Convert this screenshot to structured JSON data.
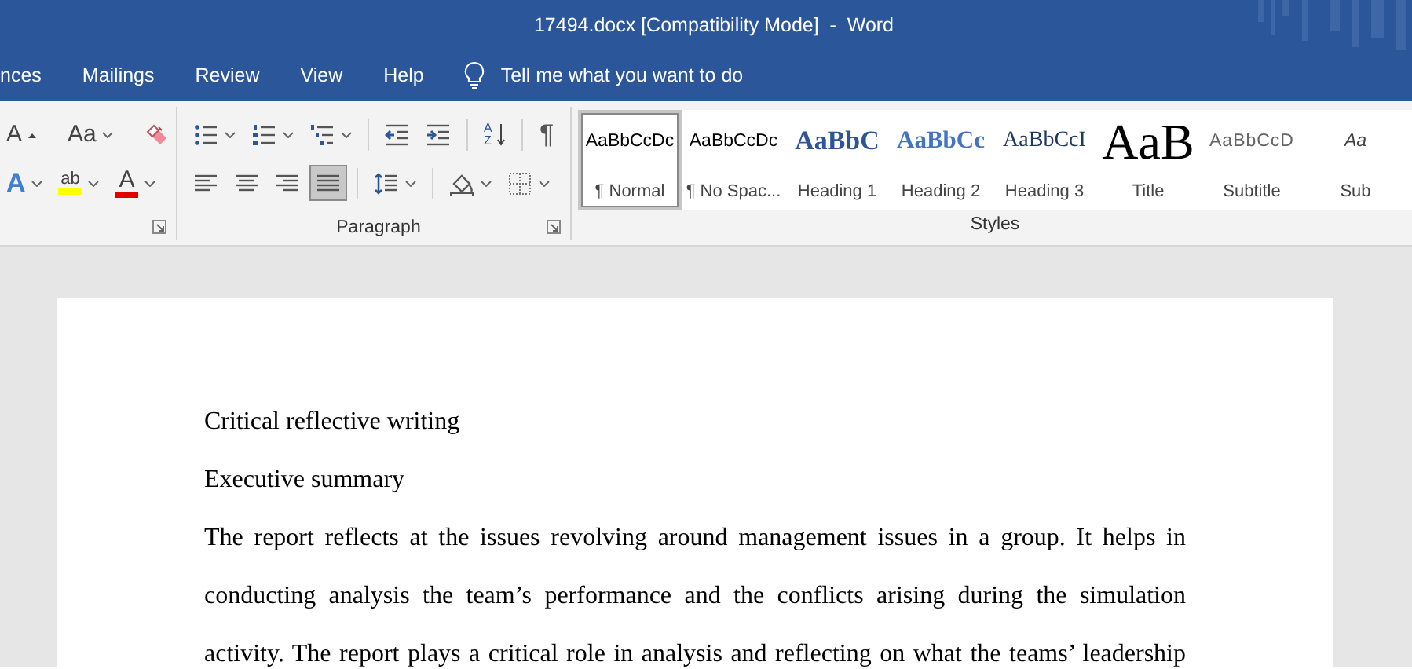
{
  "window": {
    "title": "17494.docx [Compatibility Mode]  -  Word"
  },
  "tabs": [
    {
      "label": "nces",
      "selected": false
    },
    {
      "label": "Mailings",
      "selected": false
    },
    {
      "label": "Review",
      "selected": false
    },
    {
      "label": "View",
      "selected": false
    },
    {
      "label": "Help",
      "selected": false
    }
  ],
  "tell_me": {
    "placeholder": "Tell me what you want to do"
  },
  "ribbon": {
    "font_group": {
      "upper": [
        {
          "kind": "shrink",
          "glyph": "A"
        },
        {
          "kind": "separator"
        },
        {
          "kind": "case",
          "glyph": "Aa",
          "dropdown": true
        },
        {
          "kind": "separator"
        },
        {
          "kind": "eraser"
        }
      ],
      "lower": [
        {
          "kind": "effects",
          "glyph": "A",
          "dropdown": true
        },
        {
          "kind": "highlight",
          "glyph": "ab",
          "dropdown": true
        },
        {
          "kind": "font-color",
          "glyph": "A",
          "dropdown": true
        }
      ]
    },
    "paragraph_group": {
      "label": "Paragraph",
      "rows": [
        [
          {
            "kind": "bullets",
            "dropdown": true
          },
          {
            "kind": "numbering",
            "dropdown": true
          },
          {
            "kind": "multilevel",
            "dropdown": true
          },
          {
            "kind": "separator"
          },
          {
            "kind": "outdent"
          },
          {
            "kind": "indent"
          },
          {
            "kind": "separator"
          },
          {
            "kind": "sort",
            "glyph": "AZ"
          },
          {
            "kind": "separator"
          },
          {
            "kind": "pilcrow",
            "glyph": "¶"
          }
        ],
        [
          {
            "kind": "align-left",
            "selected": false
          },
          {
            "kind": "align-center",
            "selected": false
          },
          {
            "kind": "align-right",
            "selected": false
          },
          {
            "kind": "justify",
            "selected": true
          },
          {
            "kind": "separator"
          },
          {
            "kind": "line-spacing",
            "dropdown": true
          },
          {
            "kind": "separator"
          },
          {
            "kind": "shading",
            "dropdown": true
          },
          {
            "kind": "borders",
            "dropdown": true
          }
        ]
      ]
    },
    "styles_group": {
      "label": "Styles",
      "styles": [
        {
          "kind": "normal",
          "preview": "AaBbCcDc",
          "name": "¶ Normal",
          "selected": true
        },
        {
          "kind": "normal",
          "preview": "AaBbCcDc",
          "name": "¶ No Spac...",
          "selected": false
        },
        {
          "kind": "heading1",
          "preview": "AaBbC",
          "name": "Heading 1",
          "selected": false
        },
        {
          "kind": "heading2",
          "preview": "AaBbCc",
          "name": "Heading 2",
          "selected": false
        },
        {
          "kind": "heading3",
          "preview": "AaBbCcI",
          "name": "Heading 3",
          "selected": false
        },
        {
          "kind": "title",
          "preview": "AaB",
          "name": "Title",
          "selected": false
        },
        {
          "kind": "subtitle",
          "preview": "AaBbCcD",
          "name": "Subtitle",
          "selected": false
        },
        {
          "kind": "emphasis",
          "preview": "Aa",
          "name": "Sub",
          "selected": false
        }
      ]
    }
  },
  "document": {
    "paragraphs": [
      {
        "kind": "plain",
        "text": "Critical reflective writing"
      },
      {
        "kind": "plain",
        "text": "Executive summary"
      },
      {
        "kind": "justified",
        "text": "The report reflects at the issues revolving around management issues in a group. It helps in conducting analysis the team’s performance and the conflicts arising during the simulation activity. The report plays a critical role in analysis and reflecting on what the teams’ leadership"
      }
    ]
  }
}
